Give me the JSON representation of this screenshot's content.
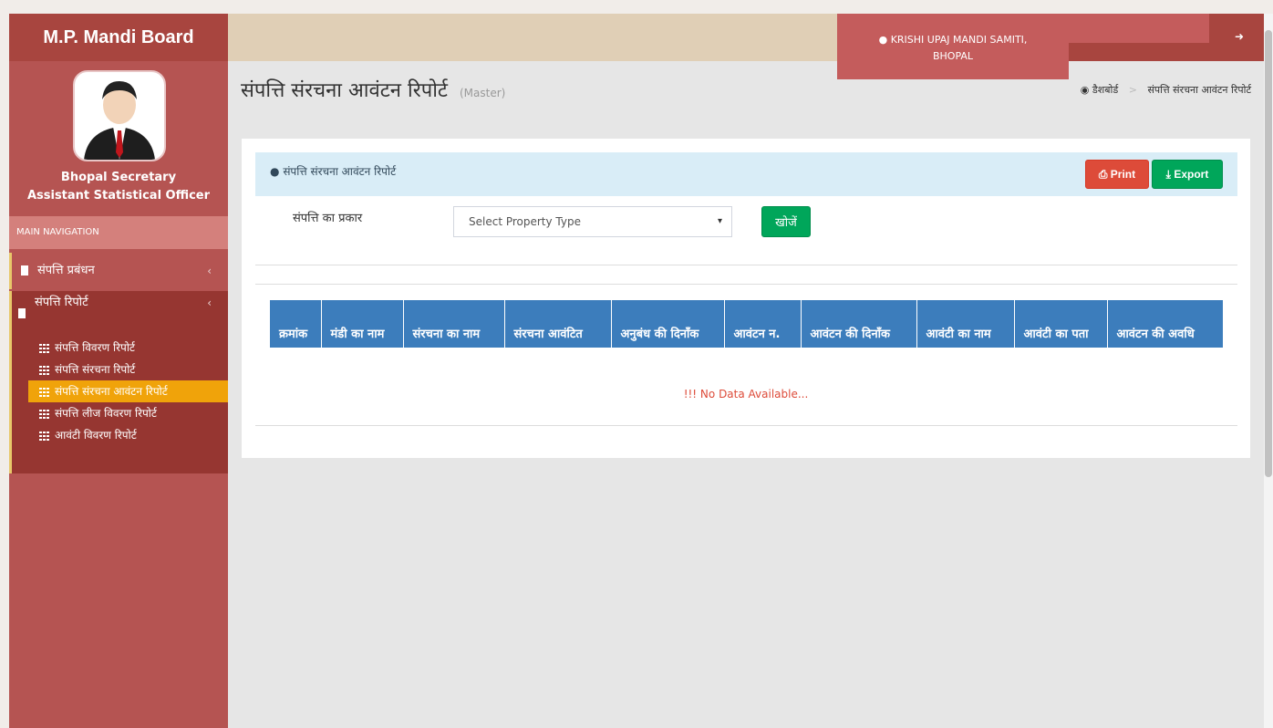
{
  "header": {
    "app_title": "M.P. Mandi Board",
    "mandi_line1": "KRISHI UPAJ MANDI SAMITI,",
    "mandi_line2": "BHOPAL"
  },
  "user": {
    "name": "Bhopal Secretary",
    "role": "Assistant Statistical Officer"
  },
  "sidebar": {
    "nav_header": "MAIN NAVIGATION",
    "items": [
      {
        "label": "संपत्ति प्रबंधन"
      },
      {
        "label": "संपत्ति रिपोर्ट",
        "subitems": [
          {
            "label": "संपत्ति विवरण रिपोर्ट"
          },
          {
            "label": "संपत्ति संरचना रिपोर्ट"
          },
          {
            "label": "संपत्ति संरचना आवंटन रिपोर्ट"
          },
          {
            "label": "संपत्ति लीज विवरण रिपोर्ट"
          },
          {
            "label": "आवंटी विवरण रिपोर्ट"
          }
        ]
      }
    ]
  },
  "page": {
    "title": "संपत्ति संरचना आवंटन रिपोर्ट",
    "subtitle": "(Master)",
    "breadcrumb": [
      "डैशबोर्ड",
      "संपत्ति संरचना आवंटन रिपोर्ट"
    ]
  },
  "panel": {
    "title": "संपत्ति संरचना आवंटन रिपोर्ट",
    "print_label": "Print",
    "export_label": "Export"
  },
  "filter": {
    "property_label": "संपत्ति का प्रकार",
    "property_select": "Select Property Type",
    "search_label": "खोजें"
  },
  "table": {
    "columns": [
      "क्रमांक",
      "मंडी का नाम",
      "संरचना का नाम",
      "संरचना आवंटित",
      "अनुबंध की दिनाँक",
      "आवंटन न.",
      "आवंटन की दिनाँक",
      "आवंटी का नाम",
      "आवंटी का पता",
      "आवंटन की अवधि"
    ],
    "empty_message": "!!! No Data Available..."
  },
  "colors": {
    "brand": "#a8453f",
    "sidebar": "#b55452",
    "active_item": "#f0a30a",
    "table_header": "#3c7dbc",
    "print": "#dd4b39",
    "export": "#00a65a"
  }
}
